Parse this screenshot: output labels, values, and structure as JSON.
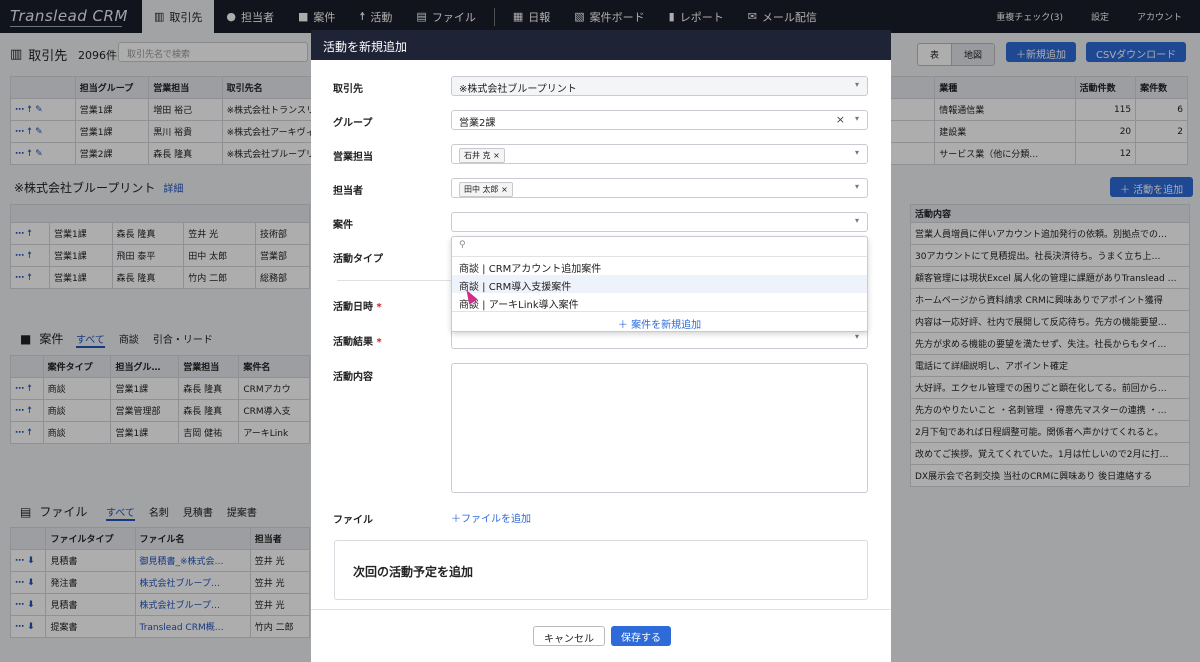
{
  "app": {
    "logo": "Translead CRM"
  },
  "nav": {
    "items": [
      {
        "label": "取引先",
        "icon": "building-icon"
      },
      {
        "label": "担当者",
        "icon": "person-icon"
      },
      {
        "label": "案件",
        "icon": "briefcase-icon"
      },
      {
        "label": "活動",
        "icon": "running-icon"
      },
      {
        "label": "ファイル",
        "icon": "file-icon"
      },
      {
        "label": "日報",
        "icon": "report-icon"
      },
      {
        "label": "案件ボード",
        "icon": "board-icon"
      },
      {
        "label": "レポート",
        "icon": "chart-icon"
      },
      {
        "label": "メール配信",
        "icon": "mail-icon"
      }
    ],
    "right": [
      "重複チェック(3)",
      "設定",
      "アカウント"
    ]
  },
  "bg": {
    "title": "取引先",
    "count": "2096件",
    "search_placeholder": "取引先名で検索",
    "view_toggle": [
      "表",
      "地図"
    ],
    "new_button": "＋新規追加",
    "csv_button": "CSVダウンロード",
    "table1": {
      "headers": [
        "担当グループ",
        "営業担当",
        "取引先名",
        "業種",
        "活動件数",
        "案件数"
      ],
      "rows": [
        [
          "営業1課",
          "増田 裕己",
          "※株式会社トランスリー",
          "情報通信業",
          "115",
          "6"
        ],
        [
          "営業1課",
          "黒川 裕貴",
          "※株式会社アーキヴィレッ",
          "建設業",
          "20",
          "2"
        ],
        [
          "営業2課",
          "森長 隆真",
          "※株式会社ブループリン",
          "サービス業（他に分類…",
          "12",
          ""
        ]
      ]
    },
    "detail_title": "※株式会社ブループリント",
    "detail_link": "詳細",
    "activity_add": "＋ 活動を追加",
    "table2": {
      "rows": [
        [
          "営業1課",
          "森長 隆真",
          "笠井 光",
          "技術部"
        ],
        [
          "営業1課",
          "飛田 泰平",
          "田中 太郎",
          "営業部"
        ],
        [
          "営業1課",
          "森長 隆真",
          "竹内 二郎",
          "総務部"
        ]
      ]
    },
    "activity_header": "活動内容",
    "activity_rows": [
      "営業人員増員に伴いアカウント追加発行の依頼。別拠点での…",
      "30アカウントにて見積提出。社長決済待ち。うまく立ち上…",
      "顧客管理には現状Excel 属人化の管理に課題がありTranslead …",
      "ホームページから資料請求 CRMに興味ありでアポイント獲得",
      "内容は一応好評、社内で展開して反応待ち。先方の機能要望…",
      "先方が求める機能の要望を満たせず、失注。社長からもタイ…",
      "電話にて詳細説明し、アポイント確定",
      "大好評。エクセル管理での困りごと顕在化してる。前回から…",
      "先方のやりたいこと ・名刺管理 ・得意先マスターの連携 ・…",
      "2月下旬であれば日程調整可能。関係者へ声かけてくれると。",
      "改めてご挨拶。覚えてくれていた。1月は忙しいので2月に打…",
      "DX展示会で名刺交換 当社のCRMに興味あり 後日連絡する"
    ],
    "deals": {
      "title": "案件",
      "tabs": [
        "すべて",
        "商談",
        "引合・リード"
      ],
      "headers": [
        "案件タイプ",
        "担当グル…",
        "営業担当",
        "案件名"
      ],
      "rows": [
        [
          "商談",
          "営業1課",
          "森長 隆真",
          "CRMアカウ"
        ],
        [
          "商談",
          "営業管理部",
          "森長 隆真",
          "CRM導入支"
        ],
        [
          "商談",
          "営業1課",
          "吉岡 健祐",
          "アーキLink"
        ]
      ]
    },
    "files": {
      "title": "ファイル",
      "tabs": [
        "すべて",
        "名刺",
        "見積書",
        "提案書"
      ],
      "headers": [
        "ファイルタイプ",
        "ファイル名",
        "担当者"
      ],
      "rows": [
        [
          "見積書",
          "御見積書_※株式会…",
          "笠井 光"
        ],
        [
          "発注書",
          "株式会社ブループ…",
          "笠井 光"
        ],
        [
          "見積書",
          "株式会社ブループ…",
          "笠井 光"
        ],
        [
          "提案書",
          "Translead CRM概…",
          "竹内 二郎"
        ]
      ]
    }
  },
  "modal": {
    "title": "活動を新規追加",
    "labels": {
      "client": "取引先",
      "group": "グループ",
      "sales": "営業担当",
      "contact": "担当者",
      "deal": "案件",
      "activity_type": "活動タイプ",
      "datetime": "活動日時",
      "result": "活動結果",
      "content": "活動内容",
      "file": "ファイル"
    },
    "values": {
      "client": "※株式会社ブループリント",
      "group": "営業2課",
      "sales_tag": "石井 克",
      "contact_tag": "田中 太郎"
    },
    "dropdown": {
      "options": [
        "商談 | CRMアカウント追加案件",
        "商談 | CRM導入支援案件",
        "商談 | アーキLink導入案件"
      ],
      "add_label": "＋ 案件を新規追加"
    },
    "add_file": "＋ファイルを追加",
    "next_plan": "次回の活動予定を追加",
    "cancel": "キャンセル",
    "save": "保存する"
  }
}
